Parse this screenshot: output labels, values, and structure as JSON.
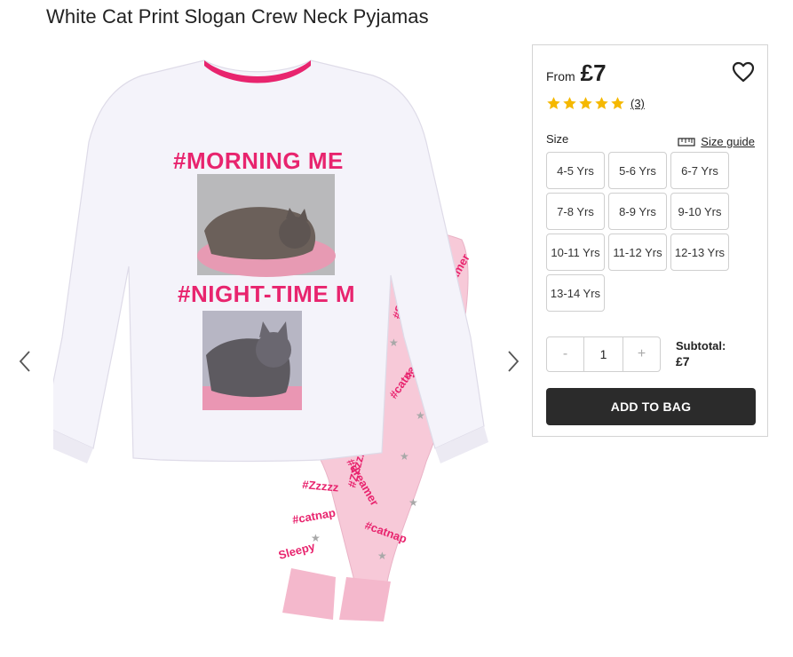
{
  "product": {
    "title": "White Cat Print Slogan Crew Neck Pyjamas",
    "image_text": {
      "slogan_top": "#MORNING ME",
      "slogan_bottom": "#NIGHT-TIME M"
    }
  },
  "gallery": {
    "prev_icon": "chevron-left-icon",
    "next_icon": "chevron-right-icon"
  },
  "purchase": {
    "from_label": "From",
    "price": "£7",
    "wishlist_icon": "heart-outline-icon",
    "rating": {
      "value": 5,
      "max": 5,
      "count_label": "(3)"
    },
    "size_label": "Size",
    "size_guide_label": "Size guide",
    "size_guide_icon": "ruler-icon",
    "sizes": [
      "4-5 Yrs",
      "5-6 Yrs",
      "6-7 Yrs",
      "7-8 Yrs",
      "8-9 Yrs",
      "9-10 Yrs",
      "10-11 Yrs",
      "11-12 Yrs",
      "12-13 Yrs",
      "13-14 Yrs"
    ],
    "quantity": {
      "minus_label": "-",
      "value": "1",
      "plus_label": "+"
    },
    "subtotal_label": "Subtotal:",
    "subtotal_value": "£7",
    "add_to_bag_label": "ADD TO BAG"
  },
  "colors": {
    "pink_accent": "#e8246e",
    "star": "#f5b800",
    "button_dark": "#2b2b2b",
    "pajama_pink": "#f7c9d8"
  }
}
